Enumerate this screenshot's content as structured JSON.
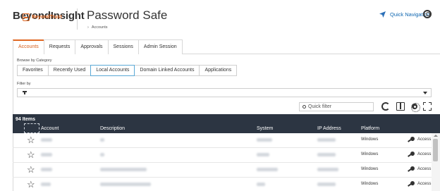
{
  "brand": {
    "name": "BeyondInsight",
    "sub": "BeyondTrust"
  },
  "app": {
    "title": "Password Safe",
    "breadcrumb_sep": "›",
    "breadcrumb": "Accounts"
  },
  "header": {
    "quick_nav": "Quick Navigation"
  },
  "tabs": [
    {
      "label": "Accounts",
      "active": true
    },
    {
      "label": "Requests"
    },
    {
      "label": "Approvals"
    },
    {
      "label": "Sessions"
    },
    {
      "label": "Admin Session"
    }
  ],
  "browse": {
    "label": "Browse by Category",
    "categories": [
      {
        "label": "Favorites"
      },
      {
        "label": "Recently Used"
      },
      {
        "label": "Local Accounts",
        "active": true
      },
      {
        "label": "Domain Linked Accounts"
      },
      {
        "label": "Applications"
      }
    ]
  },
  "filter": {
    "label": "Filter by"
  },
  "search": {
    "placeholder": "Quick filter"
  },
  "grid": {
    "count": "94 Items",
    "columns": [
      "Account",
      "Description",
      "System",
      "IP Address",
      "Platform"
    ],
    "rows": [
      {
        "platform": "Windows",
        "action": "Access"
      },
      {
        "platform": "Windows",
        "action": "Access"
      },
      {
        "platform": "Windows",
        "action": "Access"
      },
      {
        "platform": "Windows",
        "action": "Access"
      }
    ]
  },
  "colors": {
    "accent": "#e06721",
    "link": "#0e66b0",
    "grid_header": "#2c3542"
  }
}
